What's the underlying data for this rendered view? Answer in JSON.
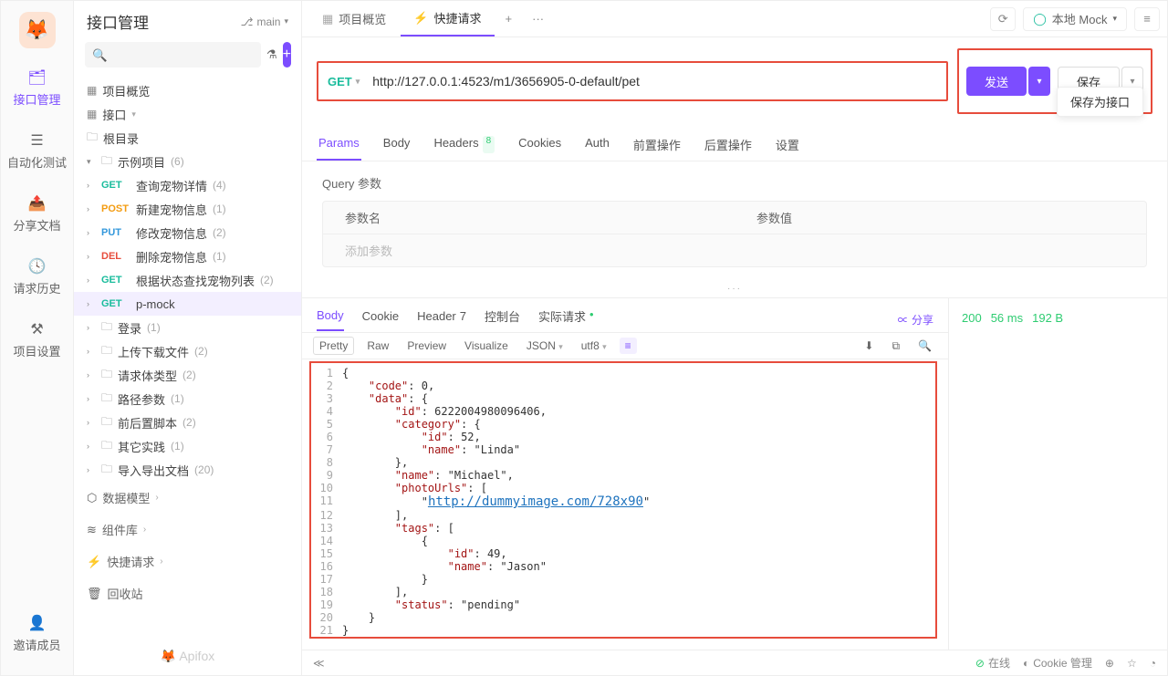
{
  "nav_rail": {
    "items": [
      {
        "icon": "🗂",
        "label": "接口管理"
      },
      {
        "icon": "⚙",
        "label": "自动化测试"
      },
      {
        "icon": "📤",
        "label": "分享文档"
      },
      {
        "icon": "🕓",
        "label": "请求历史"
      },
      {
        "icon": "⚒",
        "label": "项目设置"
      },
      {
        "icon": "👤",
        "label": "邀请成员"
      }
    ]
  },
  "sidebar": {
    "title": "接口管理",
    "branch": "main",
    "search_placeholder": "🔍",
    "overview": "项目概览",
    "api_root": "接口",
    "root_folder": "根目录",
    "example_proj": "示例项目",
    "example_proj_count": "(6)",
    "endpoints": [
      {
        "method": "GET",
        "cls": "get",
        "name": "查询宠物详情",
        "count": "(4)"
      },
      {
        "method": "POST",
        "cls": "post",
        "name": "新建宠物信息",
        "count": "(1)"
      },
      {
        "method": "PUT",
        "cls": "put",
        "name": "修改宠物信息",
        "count": "(2)"
      },
      {
        "method": "DEL",
        "cls": "del",
        "name": "删除宠物信息",
        "count": "(1)"
      },
      {
        "method": "GET",
        "cls": "get",
        "name": "根据状态查找宠物列表",
        "count": "(2)"
      },
      {
        "method": "GET",
        "cls": "get",
        "name": "p-mock",
        "count": ""
      }
    ],
    "folders": [
      {
        "name": "登录",
        "count": "(1)"
      },
      {
        "name": "上传下载文件",
        "count": "(2)"
      },
      {
        "name": "请求体类型",
        "count": "(2)"
      },
      {
        "name": "路径参数",
        "count": "(1)"
      },
      {
        "name": "前后置脚本",
        "count": "(2)"
      },
      {
        "name": "其它实践",
        "count": "(1)"
      },
      {
        "name": "导入导出文档",
        "count": "(20)"
      }
    ],
    "sections": [
      {
        "icon": "⬡",
        "name": "数据模型"
      },
      {
        "icon": "≋",
        "name": "组件库"
      },
      {
        "icon": "⚡",
        "name": "快捷请求"
      },
      {
        "icon": "🗑",
        "name": "回收站"
      }
    ],
    "footer": "🦊 Apifox"
  },
  "tabs": {
    "overview": "项目概览",
    "quick": "快捷请求",
    "env": "本地 Mock"
  },
  "request": {
    "method": "GET",
    "url": "http://127.0.0.1:4523/m1/3656905-0-default/pet",
    "send": "发送",
    "save": "保存",
    "save_as": "保存为接口"
  },
  "subtabs": {
    "params": "Params",
    "body": "Body",
    "headers": "Headers",
    "headers_badge": "8",
    "cookies": "Cookies",
    "auth": "Auth",
    "pre": "前置操作",
    "post": "后置操作",
    "settings": "设置"
  },
  "params": {
    "title": "Query 参数",
    "col_name": "参数名",
    "col_value": "参数值",
    "placeholder": "添加参数"
  },
  "resp_tabs": {
    "body": "Body",
    "cookie": "Cookie",
    "header": "Header",
    "header_badge": "7",
    "console": "控制台",
    "actual": "实际请求",
    "share": "分享"
  },
  "resp_toolbar": {
    "pretty": "Pretty",
    "raw": "Raw",
    "preview": "Preview",
    "visualize": "Visualize",
    "json": "JSON",
    "utf8": "utf8"
  },
  "resp_status": {
    "code": "200",
    "time": "56 ms",
    "size": "192 B"
  },
  "json_code": [
    {
      "n": "1",
      "t": "{"
    },
    {
      "n": "2",
      "t": "    \"code\": 0,"
    },
    {
      "n": "3",
      "t": "    \"data\": {"
    },
    {
      "n": "4",
      "t": "        \"id\": 6222004980096406,"
    },
    {
      "n": "5",
      "t": "        \"category\": {"
    },
    {
      "n": "6",
      "t": "            \"id\": 52,"
    },
    {
      "n": "7",
      "t": "            \"name\": \"Linda\""
    },
    {
      "n": "8",
      "t": "        },"
    },
    {
      "n": "9",
      "t": "        \"name\": \"Michael\","
    },
    {
      "n": "10",
      "t": "        \"photoUrls\": ["
    },
    {
      "n": "11",
      "t": "            \"http://dummyimage.com/728x90\""
    },
    {
      "n": "12",
      "t": "        ],"
    },
    {
      "n": "13",
      "t": "        \"tags\": ["
    },
    {
      "n": "14",
      "t": "            {"
    },
    {
      "n": "15",
      "t": "                \"id\": 49,"
    },
    {
      "n": "16",
      "t": "                \"name\": \"Jason\""
    },
    {
      "n": "17",
      "t": "            }"
    },
    {
      "n": "18",
      "t": "        ],"
    },
    {
      "n": "19",
      "t": "        \"status\": \"pending\""
    },
    {
      "n": "20",
      "t": "    }"
    },
    {
      "n": "21",
      "t": "}"
    }
  ],
  "status_bar": {
    "online": "在线",
    "cookie": "Cookie 管理"
  }
}
